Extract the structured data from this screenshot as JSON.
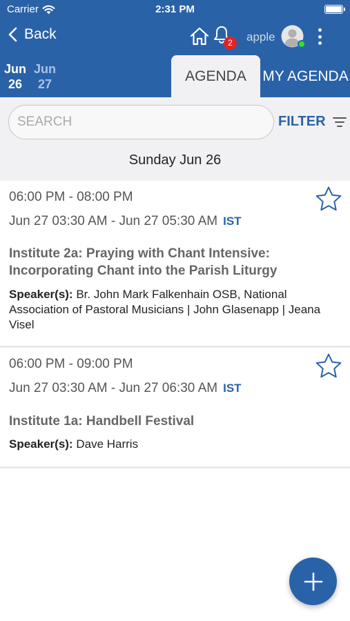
{
  "status_bar": {
    "carrier": "Carrier",
    "time": "2:31 PM"
  },
  "nav": {
    "back_label": "Back",
    "notification_count": "2",
    "user_name": "apple"
  },
  "dates": [
    {
      "month": "Jun",
      "day": "26",
      "selected": true
    },
    {
      "month": "Jun",
      "day": "27",
      "selected": false
    }
  ],
  "tabs": {
    "agenda": "AGENDA",
    "my_agenda": "MY AGENDA"
  },
  "search": {
    "placeholder": "SEARCH",
    "value": ""
  },
  "filter": {
    "label": "FILTER"
  },
  "day_heading": "Sunday Jun 26",
  "sessions": [
    {
      "time_local": "06:00 PM - 08:00 PM",
      "time_converted": "Jun 27 03:30 AM - Jun 27 05:30 AM",
      "timezone": "IST",
      "title": "Institute 2a: Praying with Chant Intensive: Incorporating Chant into the Parish Liturgy",
      "speakers_label": "Speaker(s):",
      "speakers": "Br. John Mark Falkenhain OSB, National Association of Pastoral Musicians | John Glasenapp | Jeana Visel",
      "starred": false
    },
    {
      "time_local": "06:00 PM - 09:00 PM",
      "time_converted": "Jun 27 03:30 AM - Jun 27 06:30 AM",
      "timezone": "IST",
      "title": "Institute 1a: Handbell Festival",
      "speakers_label": "Speaker(s):",
      "speakers": "Dave Harris",
      "starred": false
    }
  ],
  "colors": {
    "primary": "#2a62a8",
    "badge": "#e52222",
    "online": "#2ee32e",
    "background": "#f1f1f3"
  },
  "icons": [
    "wifi-icon",
    "battery-icon",
    "chevron-left-icon",
    "home-icon",
    "bell-icon",
    "avatar-icon",
    "more-vertical-icon",
    "filter-icon",
    "star-outline-icon",
    "plus-icon"
  ]
}
